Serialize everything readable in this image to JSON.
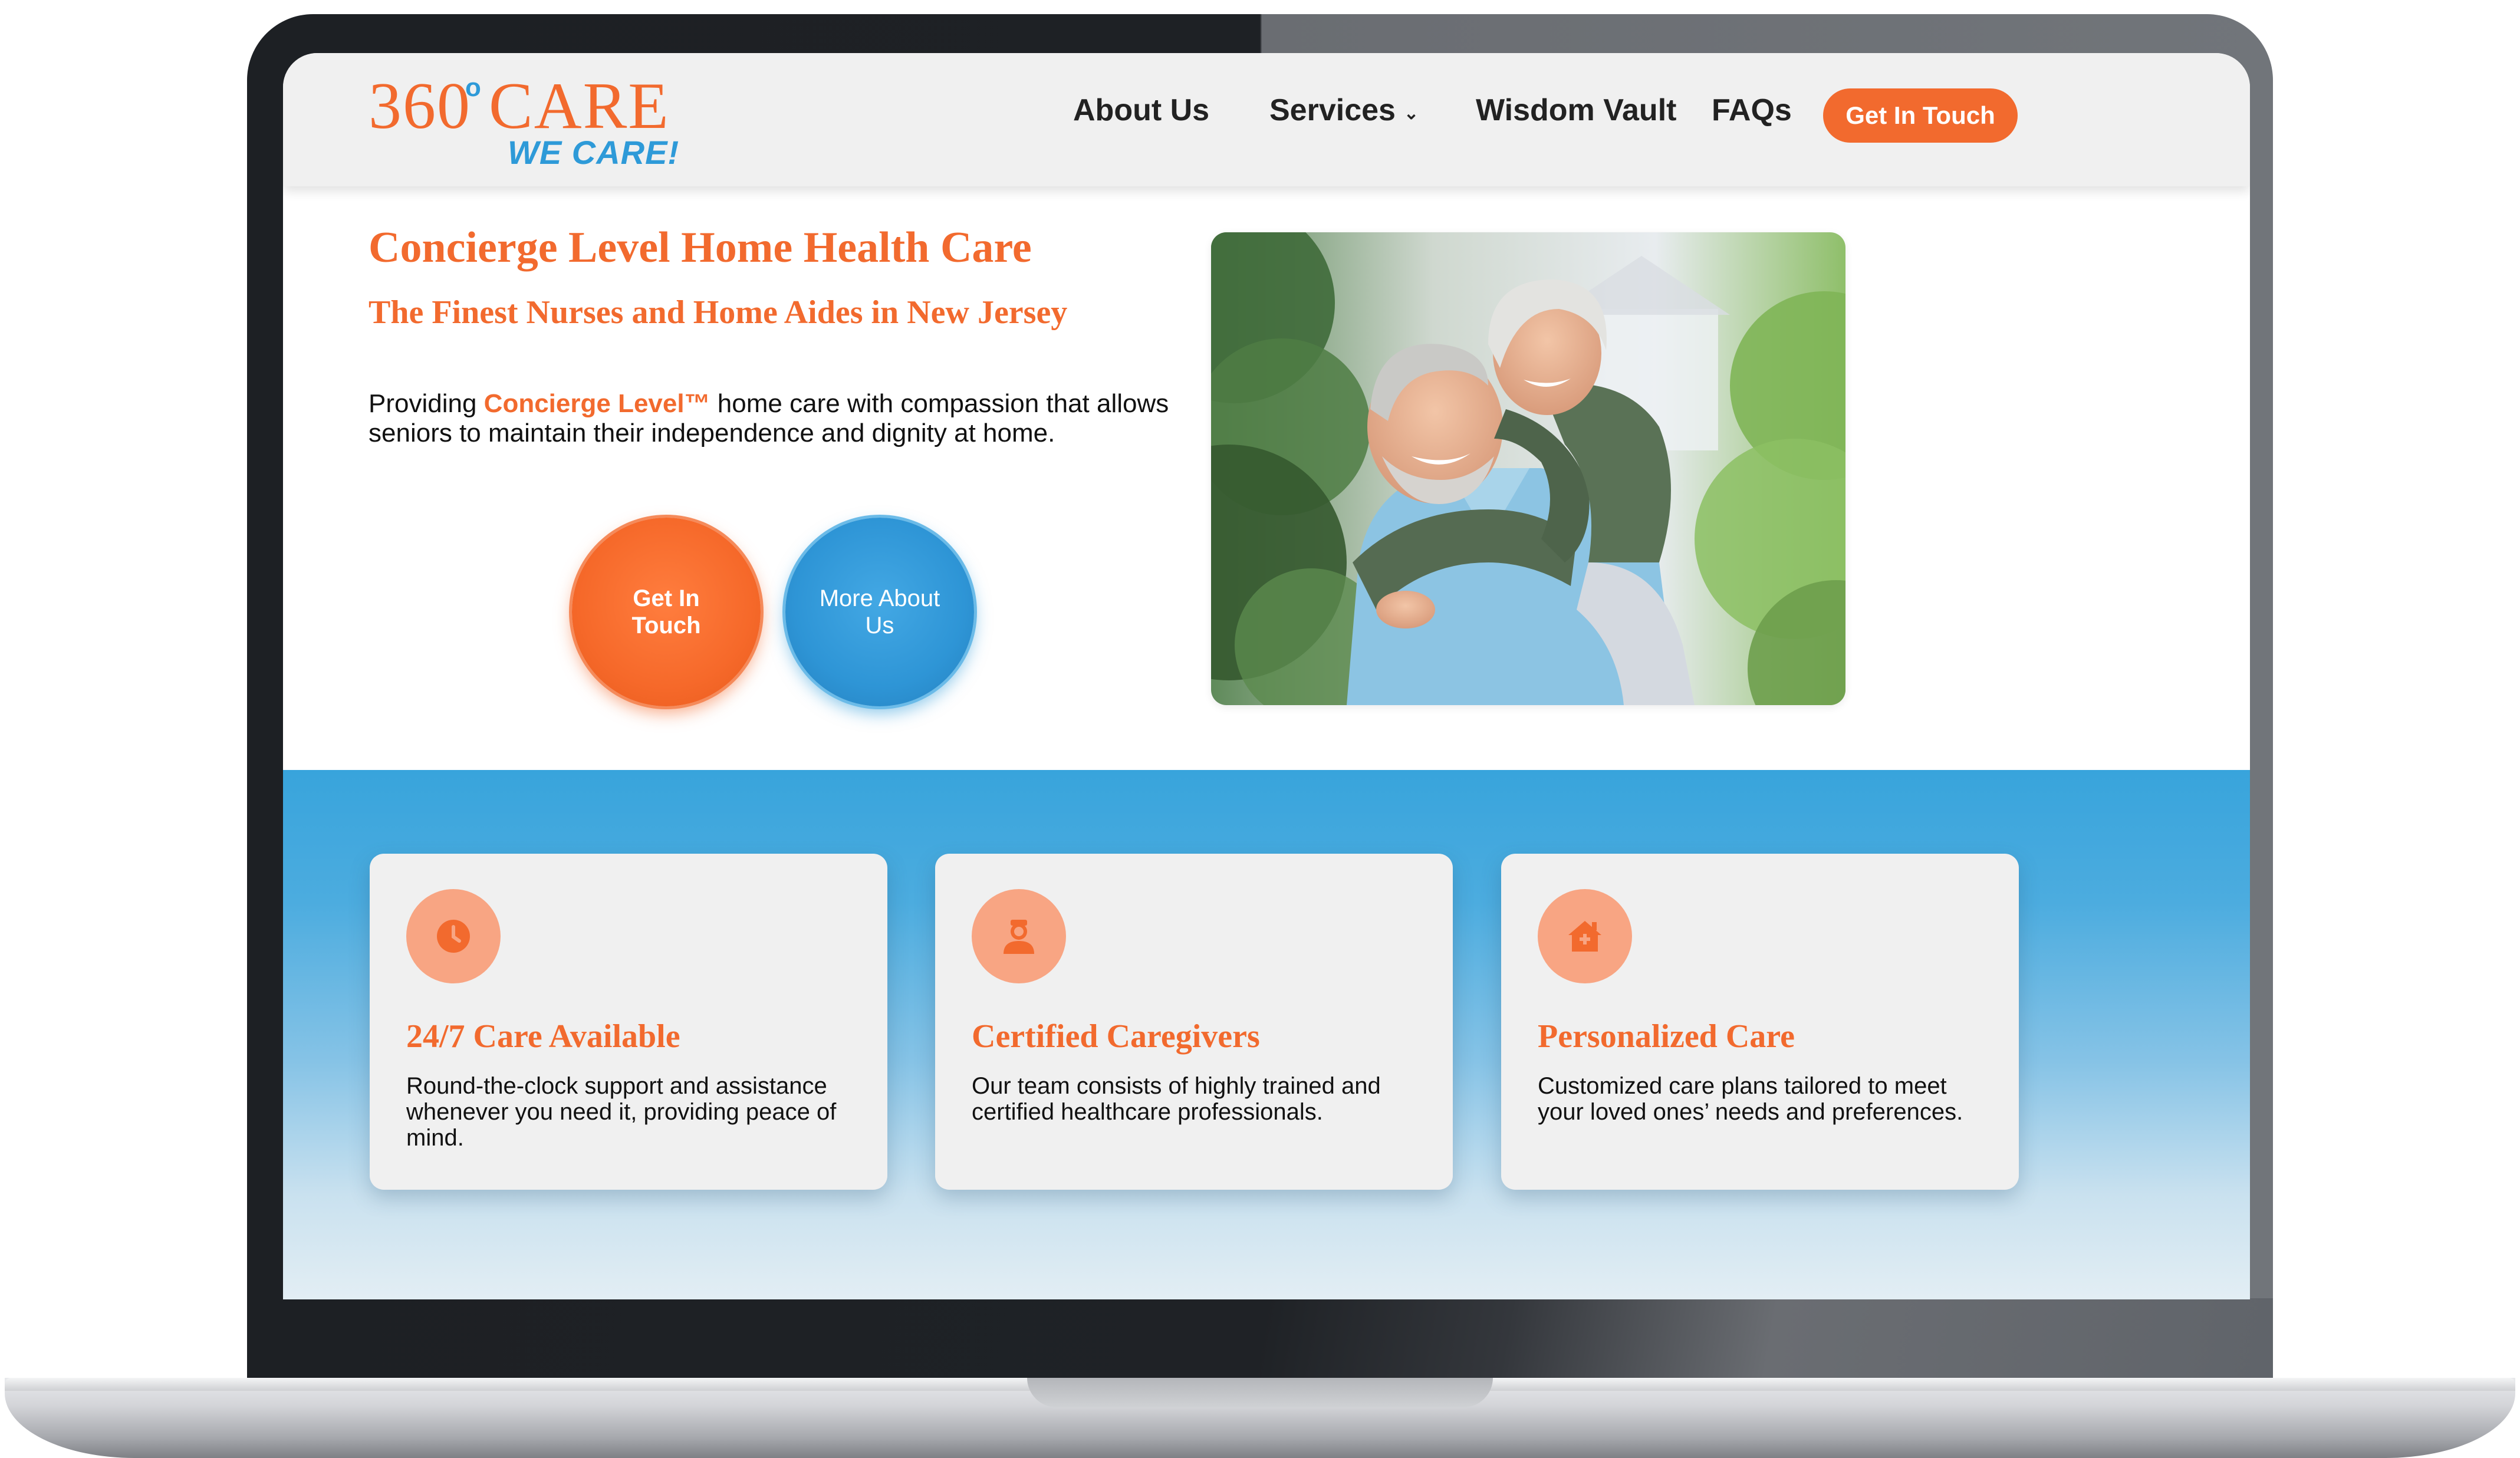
{
  "logo": {
    "main": "360 CARE",
    "degree_mark": "o",
    "tagline": "WE CARE!"
  },
  "nav": {
    "about": "About Us",
    "services": "Services",
    "services_chevron": "⌄",
    "wisdom": "Wisdom Vault",
    "faqs": "FAQs",
    "cta": "Get In Touch"
  },
  "hero": {
    "title": "Concierge Level Home Health Care",
    "subtitle": "The Finest Nurses and Home Aides in New Jersey",
    "text_before": "Providing ",
    "highlight": "Concierge Level™",
    "text_after": " home care with compassion that allows seniors to maintain their independence and dignity at home.",
    "btn_primary": "Get In Touch",
    "btn_secondary": "More About Us"
  },
  "features": [
    {
      "icon": "clock-icon",
      "title": "24/7 Care Available",
      "text": "Round-the-clock support and assistance whenever you need it, providing peace of mind."
    },
    {
      "icon": "caregiver-icon",
      "title": "Certified Caregivers",
      "text": "Our team consists of highly trained and certified healthcare professionals."
    },
    {
      "icon": "home-care-icon",
      "title": "Personalized Care",
      "text": "Customized care plans tailored to meet your loved ones’ needs and preferences."
    }
  ],
  "colors": {
    "brand_orange": "#f26a2e",
    "brand_blue": "#2e9ad8",
    "icon_bg": "#f8a583"
  }
}
